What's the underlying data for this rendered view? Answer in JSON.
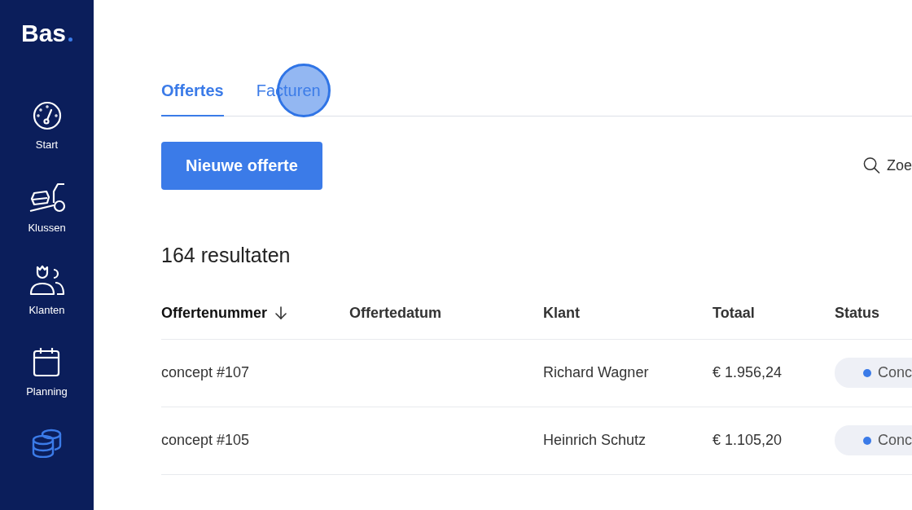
{
  "sidebar": {
    "logo": "Bas",
    "items": [
      {
        "label": "Start",
        "selected": false
      },
      {
        "label": "Klussen",
        "selected": false
      },
      {
        "label": "Klanten",
        "selected": false
      },
      {
        "label": "Planning",
        "selected": false
      },
      {
        "selected": true
      }
    ]
  },
  "tabs": [
    {
      "label": "Offertes",
      "selected": true
    },
    {
      "label": "Facturen",
      "selected": false
    }
  ],
  "new_button": "Nieuwe offerte",
  "search": {
    "placeholder": "Zoe"
  },
  "result_count": "164 resultaten",
  "table": {
    "columns": [
      {
        "label": "Offertenummer",
        "sorted": true
      },
      {
        "label": "Offertedatum",
        "sorted": false
      },
      {
        "label": "Klant",
        "sorted": false
      },
      {
        "label": "Totaal",
        "sorted": false
      },
      {
        "label": "Status",
        "sorted": false
      }
    ],
    "rows": [
      {
        "number": "concept #107",
        "client": "Richard Wagner",
        "total": "€ 1.956,24",
        "status": {
          "label": "Conc",
          "color": "#3b7be8"
        }
      },
      {
        "number": "concept #105",
        "client": "Heinrich Schutz",
        "total": "€ 1.105,20",
        "status": {
          "label": "Conc",
          "color": "#3b7be8"
        }
      }
    ]
  },
  "cursor_highlight": true
}
